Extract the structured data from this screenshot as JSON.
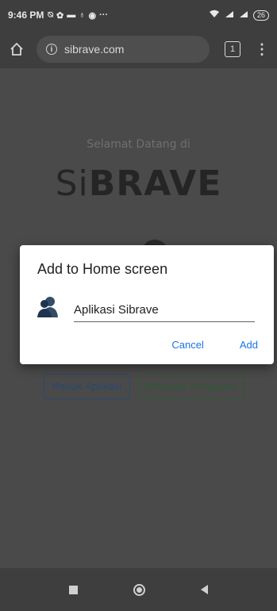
{
  "status_bar": {
    "time": "9:46 PM",
    "icons": [
      "muted-bell-icon",
      "settings-gear-icon",
      "card-icon",
      "location-pin-icon",
      "camera-icon",
      "more-dots-icon"
    ],
    "battery": "26"
  },
  "browser": {
    "url": "sibrave.com",
    "tab_count": "1"
  },
  "page": {
    "welcome": "Selamat Datang di",
    "logo_light": "Si",
    "logo_bold": "BRAVE",
    "buttons": {
      "masuk": "Masuk Aplikasi",
      "petunjuk": "Petunjuk Pengguna"
    },
    "colors": {
      "masuk": "#2c4870",
      "petunjuk": "#2e5a30"
    }
  },
  "dialog": {
    "title": "Add to Home screen",
    "app_name": "Aplikasi Sibrave",
    "cancel_label": "Cancel",
    "add_label": "Add",
    "accent": "#1a73e8"
  }
}
